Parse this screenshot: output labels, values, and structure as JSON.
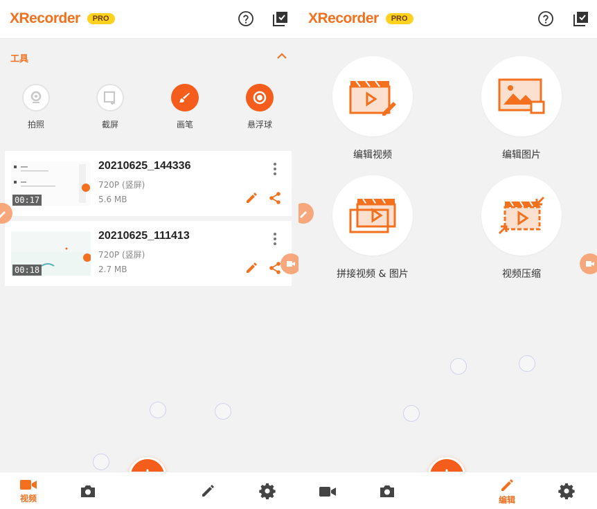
{
  "app": {
    "logo": "XRecorder",
    "badge": "PRO"
  },
  "tools": {
    "title": "工具",
    "items": [
      {
        "label": "拍照",
        "icon": "camera-lens-icon"
      },
      {
        "label": "截屏",
        "icon": "screenshot-icon"
      },
      {
        "label": "画笔",
        "icon": "brush-icon"
      },
      {
        "label": "悬浮球",
        "icon": "floating-ball-icon"
      }
    ]
  },
  "videos": [
    {
      "title": "20210625_144336",
      "resolution": "720P (竖屏)",
      "size": "5.6 MB",
      "duration": "00:17"
    },
    {
      "title": "20210625_111413",
      "resolution": "720P (竖屏)",
      "size": "2.7 MB",
      "duration": "00:18"
    }
  ],
  "edit_tools": [
    {
      "label": "编辑视频",
      "icon": "edit-video-icon"
    },
    {
      "label": "编辑图片",
      "icon": "edit-image-icon"
    },
    {
      "label": "拼接视频 & 图片",
      "icon": "merge-video-icon"
    },
    {
      "label": "视频压缩",
      "icon": "compress-video-icon"
    }
  ],
  "nav": {
    "videos_label": "视频",
    "edit_label": "编辑"
  },
  "colors": {
    "accent": "#f2701e",
    "fab": "#f45d1c",
    "badge": "#ffd21f"
  }
}
